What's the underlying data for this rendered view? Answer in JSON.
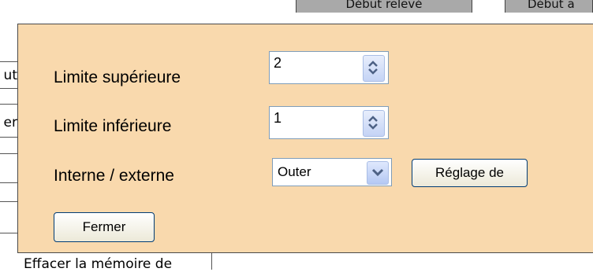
{
  "background": {
    "header_col1": "Début relevé",
    "header_col2": "Début a",
    "left_fragment_1": "ut",
    "left_fragment_2": "er",
    "bottom_text": "Effacer la mémoire de"
  },
  "dialog": {
    "upper_limit_label": "Limite supérieure",
    "upper_limit_value": "2",
    "lower_limit_label": "Limite inférieure",
    "lower_limit_value": "1",
    "inner_outer_label": "Interne / externe",
    "inner_outer_value": "Outer",
    "settings_button": "Réglage de",
    "close_button": "Fermer"
  },
  "colors": {
    "panel_background": "#f9d9ad",
    "control_border": "#7f9db9",
    "button_border": "#003c74"
  }
}
